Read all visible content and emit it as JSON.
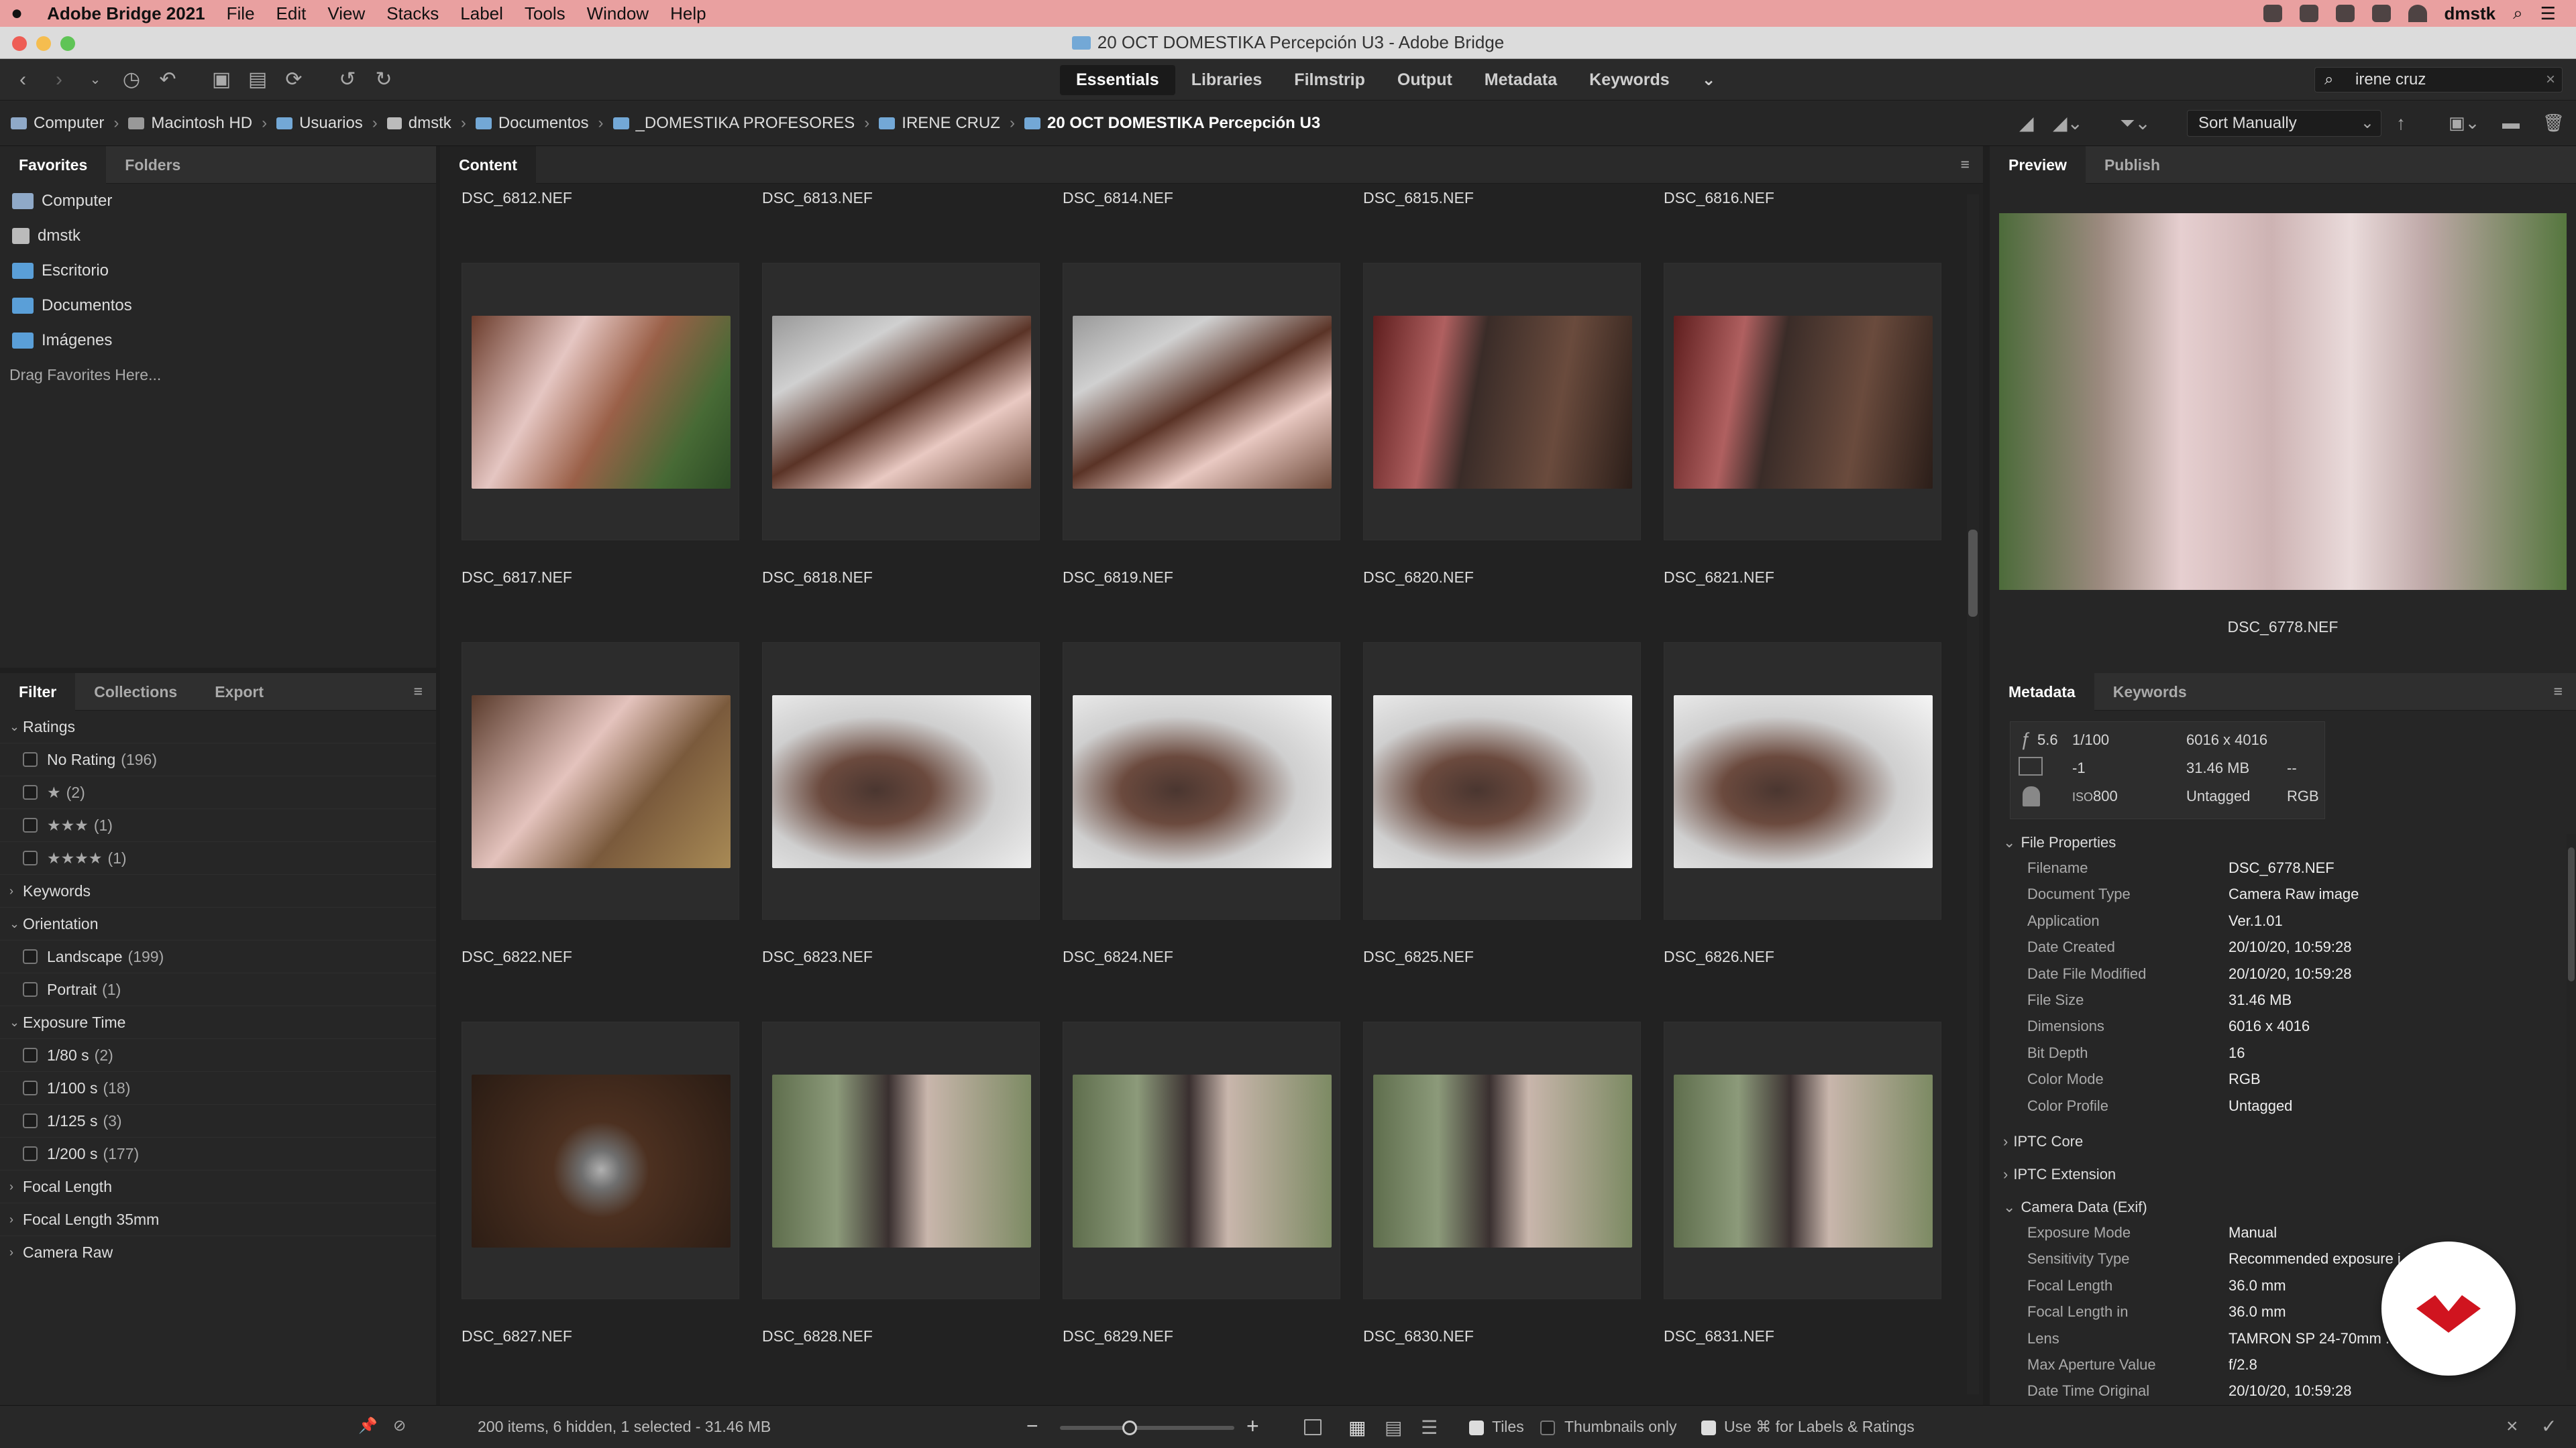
{
  "menubar": {
    "app_name": "Adobe Bridge 2021",
    "items": [
      "File",
      "Edit",
      "View",
      "Stacks",
      "Label",
      "Tools",
      "Window",
      "Help"
    ],
    "user": "dmstk"
  },
  "window": {
    "title": "20 OCT DOMESTIKA Percepción U3 - Adobe Bridge"
  },
  "toolbar": {
    "workspaces": [
      "Essentials",
      "Libraries",
      "Filmstrip",
      "Output",
      "Metadata",
      "Keywords"
    ],
    "active_workspace": "Essentials",
    "search_value": "irene cruz"
  },
  "path": {
    "crumbs": [
      "Computer",
      "Macintosh HD",
      "Usuarios",
      "dmstk",
      "Documentos",
      "_DOMESTIKA PROFESORES",
      "IRENE CRUZ",
      "20 OCT DOMESTIKA Percepción U3"
    ],
    "sort": "Sort Manually"
  },
  "left": {
    "tabs": [
      "Favorites",
      "Folders"
    ],
    "favorites": [
      {
        "label": "Computer",
        "icon": "computer-icon"
      },
      {
        "label": "dmstk",
        "icon": "home-icon"
      },
      {
        "label": "Escritorio",
        "icon": "folder-icon"
      },
      {
        "label": "Documentos",
        "icon": "folder-icon"
      },
      {
        "label": "Imágenes",
        "icon": "folder-icon"
      }
    ],
    "drag_hint": "Drag Favorites Here...",
    "filter_tabs": [
      "Filter",
      "Collections",
      "Export"
    ],
    "filter": {
      "ratings_label": "Ratings",
      "no_rating": "No Rating",
      "no_rating_count": "(196)",
      "one_star": "★",
      "one_star_count": "(2)",
      "three_star": "★★★",
      "three_star_count": "(1)",
      "four_star": "★★★★",
      "four_star_count": "(1)",
      "keywords_label": "Keywords",
      "orientation_label": "Orientation",
      "landscape": "Landscape",
      "landscape_count": "(199)",
      "portrait": "Portrait",
      "portrait_count": "(1)",
      "exposure_label": "Exposure Time",
      "exp1": "1/80 s",
      "exp1_count": "(2)",
      "exp2": "1/100 s",
      "exp2_count": "(18)",
      "exp3": "1/125 s",
      "exp3_count": "(3)",
      "exp4": "1/200 s",
      "exp4_count": "(177)",
      "focal_label": "Focal Length",
      "focal35_label": "Focal Length 35mm",
      "camera_raw_label": "Camera Raw"
    }
  },
  "content": {
    "tab": "Content",
    "top_labels": [
      "DSC_6812.NEF",
      "DSC_6813.NEF",
      "DSC_6814.NEF",
      "DSC_6815.NEF",
      "DSC_6816.NEF"
    ],
    "rows": [
      [
        "DSC_6817.NEF",
        "DSC_6818.NEF",
        "DSC_6819.NEF",
        "DSC_6820.NEF",
        "DSC_6821.NEF"
      ],
      [
        "DSC_6822.NEF",
        "DSC_6823.NEF",
        "DSC_6824.NEF",
        "DSC_6825.NEF",
        "DSC_6826.NEF"
      ],
      [
        "DSC_6827.NEF",
        "DSC_6828.NEF",
        "DSC_6829.NEF",
        "DSC_6830.NEF",
        "DSC_6831.NEF"
      ]
    ]
  },
  "right": {
    "tabs": [
      "Preview",
      "Publish"
    ],
    "preview_name": "DSC_6778.NEF",
    "meta_tabs": [
      "Metadata",
      "Keywords"
    ],
    "summary": {
      "aperture": "5.6",
      "shutter": "1/100",
      "exposure_comp": "-1",
      "iso": "800",
      "dimensions": "6016 x 4016",
      "size": "31.46 MB",
      "dash": "--",
      "profile": "Untagged",
      "mode": "RGB"
    },
    "file_properties_label": "File Properties",
    "file_properties": [
      [
        "Filename",
        "DSC_6778.NEF"
      ],
      [
        "Document Type",
        "Camera Raw image"
      ],
      [
        "Application",
        "Ver.1.01"
      ],
      [
        "Date Created",
        "20/10/20, 10:59:28"
      ],
      [
        "Date File Modified",
        "20/10/20, 10:59:28"
      ],
      [
        "File Size",
        "31.46 MB"
      ],
      [
        "Dimensions",
        "6016 x 4016"
      ],
      [
        "Bit Depth",
        "16"
      ],
      [
        "Color Mode",
        "RGB"
      ],
      [
        "Color Profile",
        "Untagged"
      ]
    ],
    "iptc_core": "IPTC Core",
    "iptc_ext": "IPTC Extension",
    "camera_data_label": "Camera Data (Exif)",
    "camera_data": [
      [
        "Exposure Mode",
        "Manual"
      ],
      [
        "Sensitivity Type",
        "Recommended exposure i..."
      ],
      [
        "Focal Length",
        "36.0 mm"
      ],
      [
        "Focal Length in",
        "36.0 mm"
      ],
      [
        "Lens",
        "TAMRON SP 24-70mm ... A007N"
      ],
      [
        "Max Aperture Value",
        "f/2.8"
      ],
      [
        "Date Time Original",
        "20/10/20, 10:59:28"
      ]
    ]
  },
  "status": {
    "summary": "200 items, 6 hidden, 1 selected - 31.46 MB",
    "zoom_percent": 40,
    "tiles": "Tiles",
    "thumbs_only": "Thumbnails only",
    "use_cmd": "Use ⌘ for Labels & Ratings"
  },
  "colors": {
    "accent": "#73a8d6",
    "menubar": "#e9a0a0",
    "brand_badge": "#d0141f"
  }
}
